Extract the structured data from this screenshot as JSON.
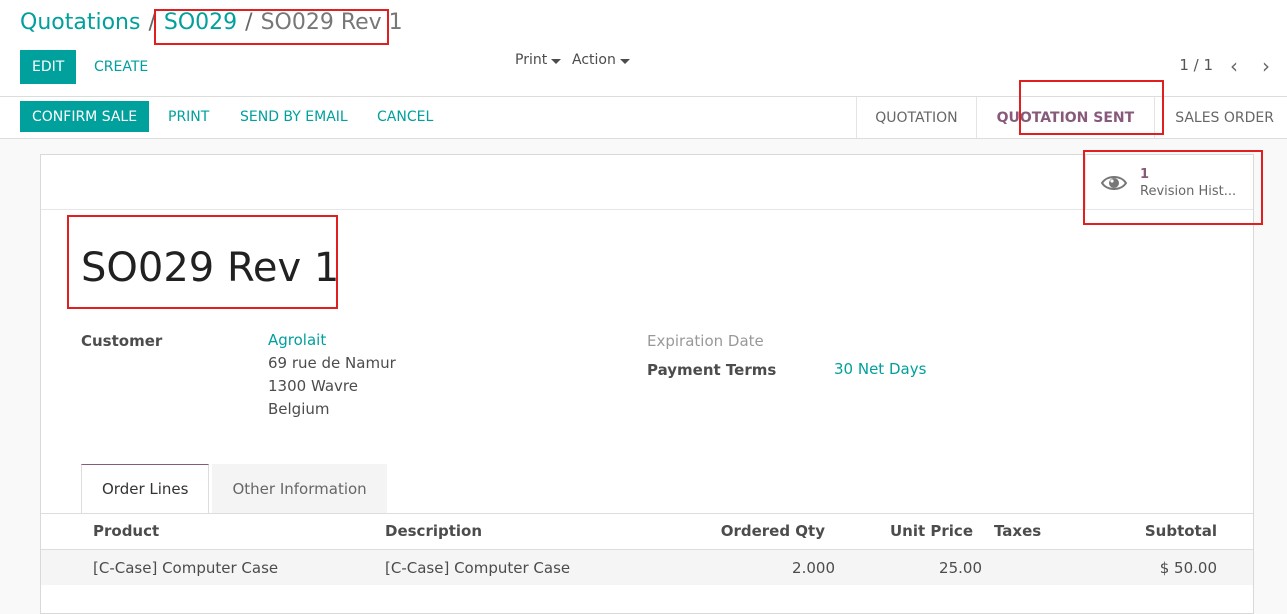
{
  "breadcrumb": {
    "root": "Quotations",
    "parent": "SO029",
    "current": "SO029 Rev 1",
    "separator": "/"
  },
  "toolbar": {
    "edit": "EDIT",
    "create": "CREATE",
    "print": "Print",
    "action": "Action",
    "pager": "1 / 1"
  },
  "statusbar_buttons": {
    "confirm": "CONFIRM SALE",
    "print": "PRINT",
    "send": "SEND BY EMAIL",
    "cancel": "CANCEL"
  },
  "stages": [
    "QUOTATION",
    "QUOTATION SENT",
    "SALES ORDER"
  ],
  "active_stage": "QUOTATION SENT",
  "smart_button": {
    "count": "1",
    "label": "Revision Hist..."
  },
  "record": {
    "title": "SO029 Rev 1",
    "customer_label": "Customer",
    "customer_name": "Agrolait",
    "address": [
      "69 rue de Namur",
      "1300 Wavre",
      "Belgium"
    ],
    "expiration_label": "Expiration Date",
    "payment_terms_label": "Payment Terms",
    "payment_terms": "30 Net Days"
  },
  "tabs": [
    "Order Lines",
    "Other Information"
  ],
  "table": {
    "headers": [
      "Product",
      "Description",
      "Ordered Qty",
      "Unit Price",
      "Taxes",
      "Subtotal"
    ],
    "rows": [
      [
        "[C-Case] Computer Case",
        "[C-Case] Computer Case",
        "2.000",
        "25.00",
        "",
        "$ 50.00"
      ]
    ]
  },
  "colors": {
    "accent": "#00a09d",
    "active_stage": "#875a7b",
    "highlight": "#e02020"
  }
}
